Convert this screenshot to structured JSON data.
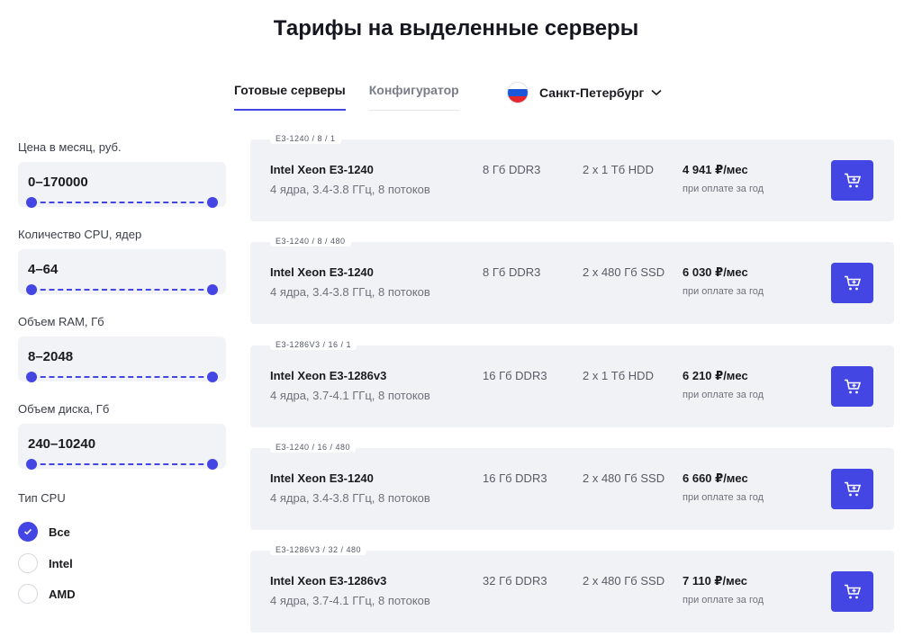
{
  "page_title": "Тарифы на выделенные серверы",
  "tabs": [
    {
      "label": "Готовые серверы",
      "active": true
    },
    {
      "label": "Конфигуратор",
      "active": false
    }
  ],
  "region": {
    "name": "Санкт-Петербург",
    "flag": [
      "#ffffff",
      "#1c57d8",
      "#e5262b"
    ]
  },
  "filters": {
    "price": {
      "label": "Цена в месяц, руб.",
      "value": "0–170000"
    },
    "cpu": {
      "label": "Количество CPU, ядер",
      "value": "4–64"
    },
    "ram": {
      "label": "Объем RAM, Гб",
      "value": "8–2048"
    },
    "disk": {
      "label": "Объем диска, Гб",
      "value": "240–10240"
    },
    "cpu_type": {
      "label": "Тип CPU",
      "options": [
        {
          "label": "Все",
          "checked": true
        },
        {
          "label": "Intel",
          "checked": false
        },
        {
          "label": "AMD",
          "checked": false
        }
      ]
    }
  },
  "servers": [
    {
      "tag": "E3-1240 / 8 / 1",
      "cpu": "Intel Xeon E3-1240",
      "spec": "4 ядра, 3.4-3.8 ГГц, 8 потоков",
      "ram": "8 Гб DDR3",
      "disk": "2 х 1 Тб HDD",
      "price": "4 941 ₽/мес",
      "note": "при оплате за год"
    },
    {
      "tag": "E3-1240 / 8 / 480",
      "cpu": "Intel Xeon E3-1240",
      "spec": "4 ядра, 3.4-3.8 ГГц, 8 потоков",
      "ram": "8 Гб DDR3",
      "disk": "2 х 480 Гб SSD",
      "price": "6 030 ₽/мес",
      "note": "при оплате за год"
    },
    {
      "tag": "E3-1286V3 / 16 / 1",
      "cpu": "Intel Xeon E3-1286v3",
      "spec": "4 ядра, 3.7-4.1 ГГц, 8 потоков",
      "ram": "16 Гб DDR3",
      "disk": "2 х 1 Тб HDD",
      "price": "6 210 ₽/мес",
      "note": "при оплате за год"
    },
    {
      "tag": "E3-1240 / 16 / 480",
      "cpu": "Intel Xeon E3-1240",
      "spec": "4 ядра, 3.4-3.8 ГГц, 8 потоков",
      "ram": "16 Гб DDR3",
      "disk": "2 х 480 Гб SSD",
      "price": "6 660 ₽/мес",
      "note": "при оплате за год"
    },
    {
      "tag": "E3-1286V3 / 32 / 480",
      "cpu": "Intel Xeon E3-1286v3",
      "spec": "4 ядра, 3.7-4.1 ГГц, 8 потоков",
      "ram": "32 Гб DDR3",
      "disk": "2 х 480 Гб SSD",
      "price": "7 110 ₽/мес",
      "note": "при оплате за год"
    }
  ],
  "colors": {
    "accent": "#4446e4",
    "card_bg": "#f1f2f5"
  }
}
